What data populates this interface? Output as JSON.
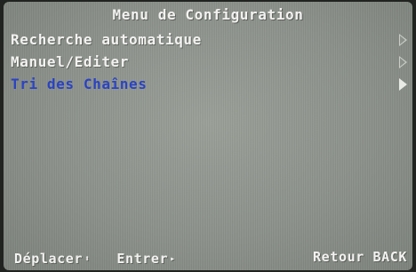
{
  "menu": {
    "title": "Menu de Configuration",
    "items": [
      {
        "label": "Recherche automatique",
        "selected": false,
        "icon": "chevron-right-icon"
      },
      {
        "label": "Manuel/Editer",
        "selected": false,
        "icon": "chevron-right-icon"
      },
      {
        "label": "Tri des Chaînes",
        "selected": true,
        "icon": "chevron-right-icon"
      }
    ]
  },
  "footer": {
    "move_label": "Déplacer",
    "move_glyph": "⬍",
    "enter_label": "Entrer",
    "enter_glyph": "▸",
    "back_label": "Retour BACK"
  },
  "colors": {
    "screen_background": "#8b918a",
    "text": "#f2f2f0",
    "selected_text": "#2b43c2"
  }
}
